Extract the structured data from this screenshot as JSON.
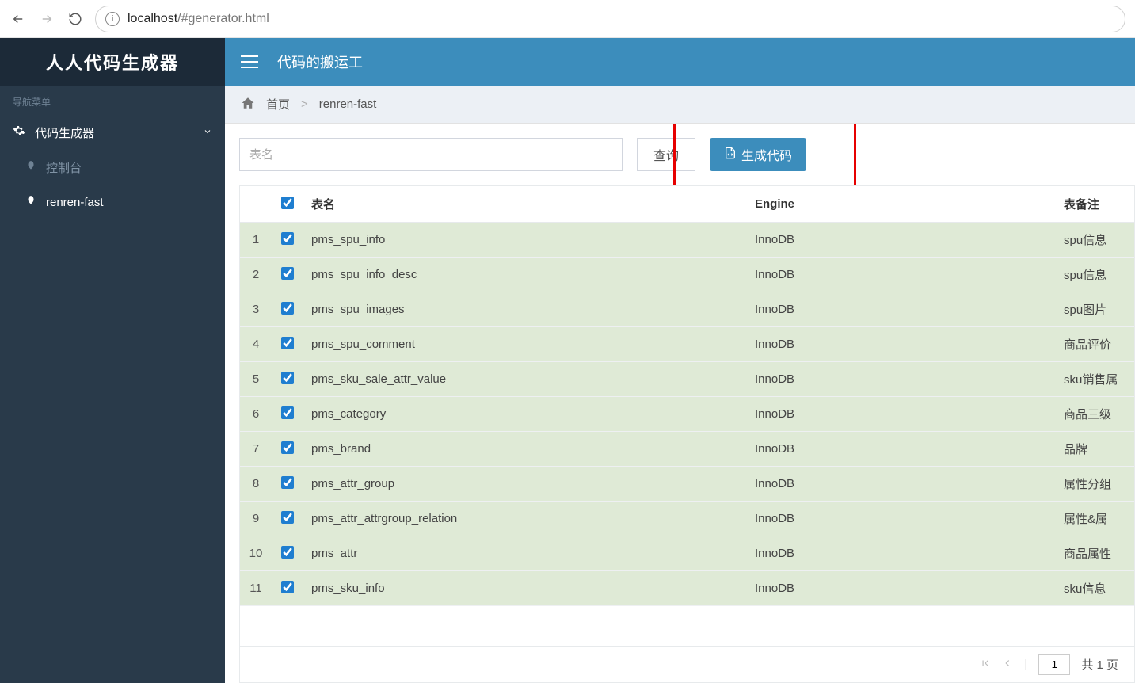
{
  "browser": {
    "url_host": "localhost",
    "url_rest": "/#generator.html"
  },
  "sidebar": {
    "brand": "人人代码生成器",
    "nav_label": "导航菜单",
    "parent": "代码生成器",
    "children": [
      {
        "label": "控制台",
        "active": false
      },
      {
        "label": "renren-fast",
        "active": true
      }
    ]
  },
  "topbar": {
    "slogan": "代码的搬运工"
  },
  "breadcrumb": {
    "home": "首页",
    "current": "renren-fast"
  },
  "toolbar": {
    "search_placeholder": "表名",
    "query": "查询",
    "generate": "生成代码"
  },
  "table": {
    "headers": {
      "name": "表名",
      "engine": "Engine",
      "remark": "表备注"
    },
    "rows": [
      {
        "name": "pms_spu_info",
        "engine": "InnoDB",
        "remark": "spu信息"
      },
      {
        "name": "pms_spu_info_desc",
        "engine": "InnoDB",
        "remark": "spu信息"
      },
      {
        "name": "pms_spu_images",
        "engine": "InnoDB",
        "remark": "spu图片"
      },
      {
        "name": "pms_spu_comment",
        "engine": "InnoDB",
        "remark": "商品评价"
      },
      {
        "name": "pms_sku_sale_attr_value",
        "engine": "InnoDB",
        "remark": "sku销售属"
      },
      {
        "name": "pms_category",
        "engine": "InnoDB",
        "remark": "商品三级"
      },
      {
        "name": "pms_brand",
        "engine": "InnoDB",
        "remark": "品牌"
      },
      {
        "name": "pms_attr_group",
        "engine": "InnoDB",
        "remark": "属性分组"
      },
      {
        "name": "pms_attr_attrgroup_relation",
        "engine": "InnoDB",
        "remark": "属性&属"
      },
      {
        "name": "pms_attr",
        "engine": "InnoDB",
        "remark": "商品属性"
      },
      {
        "name": "pms_sku_info",
        "engine": "InnoDB",
        "remark": "sku信息"
      }
    ]
  },
  "pager": {
    "page": "1",
    "total": "共 1 页"
  }
}
